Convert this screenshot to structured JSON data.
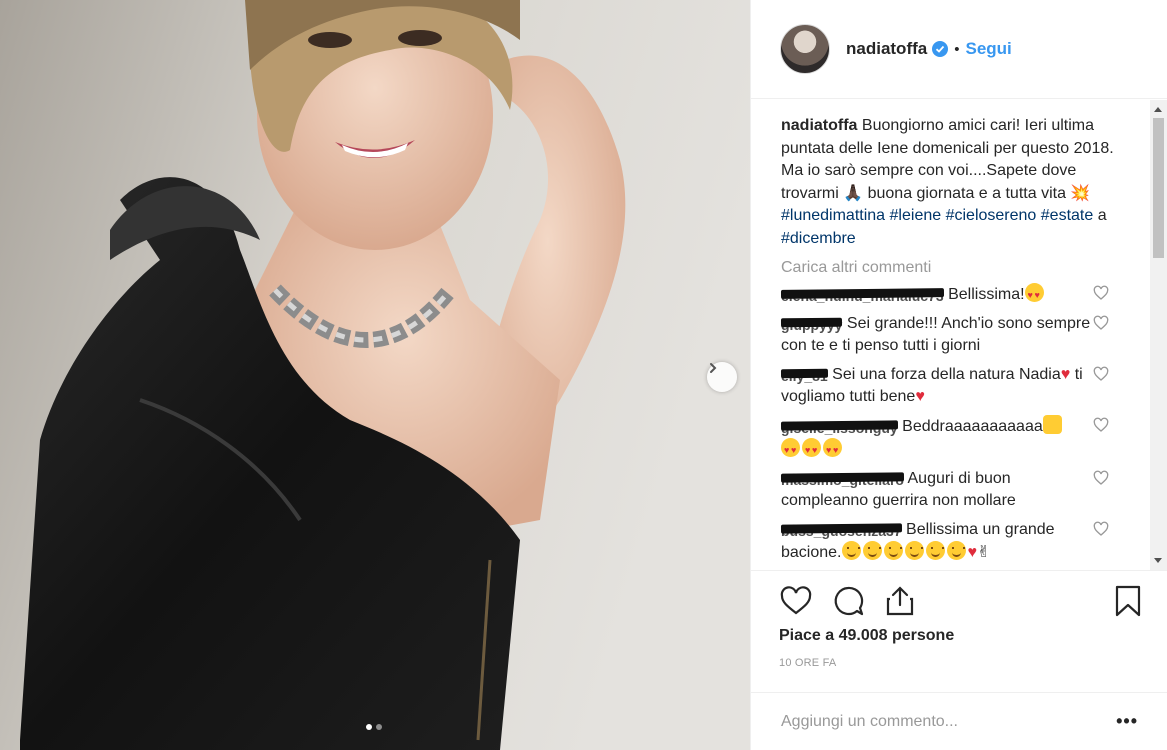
{
  "post": {
    "username": "nadiatoffa",
    "follow_label": "Segui",
    "separator": "•",
    "caption_user": "nadiatoffa",
    "caption_text": " Buongiorno amici cari! Ieri ultima puntata delle Iene domenicali per questo 2018. Ma io sarò sempre con voi....Sapete dove trovarmi 🙏🏿 buona giornata e a tutta vita 💥 ",
    "hashtags": [
      "#lunedimattina",
      "#leiene",
      "#cielosereno",
      "#estate",
      "#dicembre"
    ],
    "hashtag_joiner": "a",
    "load_more": "Carica altri commenti",
    "comments": [
      {
        "user_redacted": "elena_nuinu_marialuc73",
        "text": " Bellissima!"
      },
      {
        "user_redacted": "giuppyyy",
        "text": " Sei grande!!! Anch'io sono sempre con te e ti penso tutti i giorni"
      },
      {
        "user_redacted": "elly_81",
        "text": " Sei una forza della natura Nadia",
        "text2": " ti vogliamo tutti bene"
      },
      {
        "user_redacted": "giselle_lissonguy",
        "text": " Beddraaaaaaaaaaa"
      },
      {
        "user_redacted": "massimo_gitellaro",
        "text": " Auguri di buon compleanno guerrira non mollare"
      },
      {
        "user_redacted": "buss_guosenza37",
        "text": " Bellissima un grande bacione."
      }
    ],
    "likes_text": "Piace a 49.008 persone",
    "time_text": "10 ORE FA",
    "add_comment_placeholder": "Aggiungi un commento...",
    "more_label": "•••"
  },
  "carousel": {
    "slide_count": 2,
    "active_index": 0
  },
  "colors": {
    "accent": "#3897f0",
    "hashtag": "#003569",
    "muted": "#999999",
    "verified": "#3897f0",
    "like_red": "#ed4956"
  },
  "icons": [
    "chevron-right-icon",
    "verified-badge-icon",
    "heart-icon",
    "comment-icon",
    "share-icon",
    "bookmark-icon",
    "more-options-icon"
  ]
}
